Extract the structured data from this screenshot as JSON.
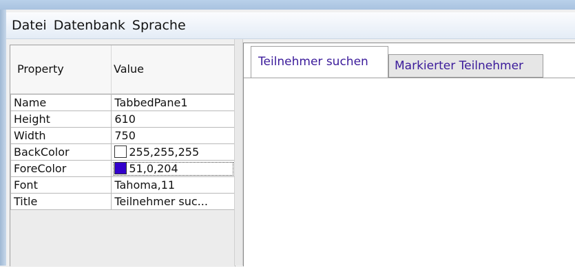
{
  "menubar": {
    "items": [
      "Datei",
      "Datenbank",
      "Sprache"
    ]
  },
  "properties": {
    "header": {
      "property": "Property",
      "value": "Value"
    },
    "rows": [
      {
        "key": "Name",
        "value": "TabbedPane1"
      },
      {
        "key": "Height",
        "value": "610"
      },
      {
        "key": "Width",
        "value": "750"
      },
      {
        "key": "BackColor",
        "value": "255,255,255",
        "swatch": "#ffffff"
      },
      {
        "key": "ForeColor",
        "value": "51,0,204",
        "swatch": "#3300cc"
      },
      {
        "key": "Font",
        "value": "Tahoma,11"
      },
      {
        "key": "Title",
        "value": "Teilnehmer suc..."
      }
    ]
  },
  "tabs": [
    {
      "label": "Teilnehmer suchen",
      "active": true
    },
    {
      "label": "Markierter Teilnehmer",
      "active": false
    }
  ],
  "colors": {
    "tab_text": "#3a1a9a",
    "forecolor_swatch": "#3300cc",
    "backcolor_swatch": "#ffffff"
  }
}
